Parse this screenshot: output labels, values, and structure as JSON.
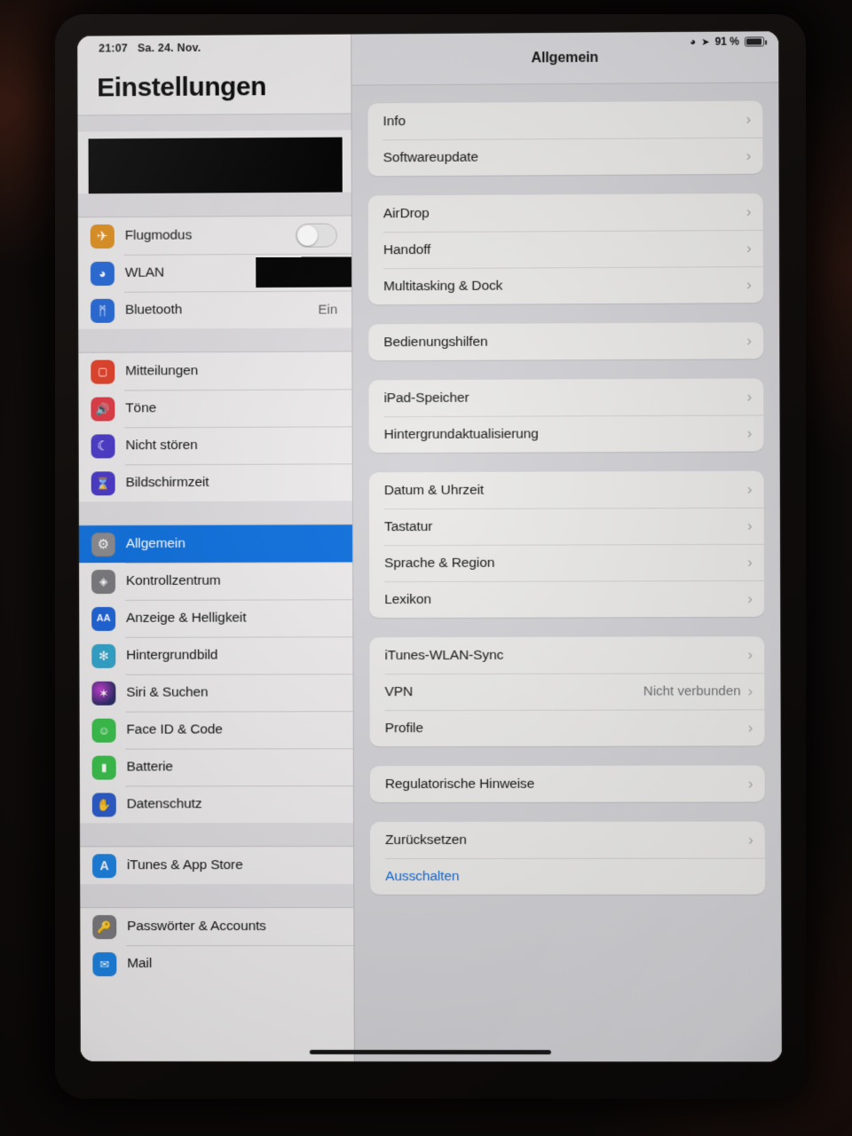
{
  "statusbar": {
    "time": "21:07",
    "date": "Sa. 24. Nov.",
    "wifi_icon": "wifi-icon",
    "location_icon": "location-arrow-icon",
    "battery_percent": "91 %",
    "battery_icon": "battery-icon"
  },
  "sidebar": {
    "title": "Einstellungen",
    "account_redacted": true,
    "groups": [
      {
        "items": [
          {
            "label": "Flugmodus",
            "icon": "airplane-icon",
            "glyph": "✈",
            "icon_color": "#e08c16",
            "control": "toggle",
            "toggle_on": false
          },
          {
            "label": "WLAN",
            "icon": "wifi-icon",
            "glyph": "◔",
            "icon_color": "#1c63d8",
            "control": "redacted"
          },
          {
            "label": "Bluetooth",
            "icon": "bluetooth-icon",
            "glyph": "ᛗ",
            "icon_color": "#1c63d8",
            "value": "Ein"
          }
        ]
      },
      {
        "items": [
          {
            "label": "Mitteilungen",
            "icon": "notifications-icon",
            "glyph": "▢",
            "icon_color": "#e23a22"
          },
          {
            "label": "Töne",
            "icon": "sounds-icon",
            "glyph": "◂",
            "icon_color": "#e0343f"
          },
          {
            "label": "Nicht stören",
            "icon": "moon-icon",
            "glyph": "☾",
            "icon_color": "#4634c9"
          },
          {
            "label": "Bildschirmzeit",
            "icon": "hourglass-icon",
            "glyph": "⧗",
            "icon_color": "#4634c9"
          }
        ]
      },
      {
        "items": [
          {
            "label": "Allgemein",
            "icon": "gear-icon",
            "glyph": "⚙",
            "icon_color": "#8b8a8e",
            "selected": true
          },
          {
            "label": "Kontrollzentrum",
            "icon": "control-center-icon",
            "glyph": "⚇",
            "icon_color": "#7a7a7e"
          },
          {
            "label": "Anzeige & Helligkeit",
            "icon": "display-brightness-icon",
            "glyph": "AA",
            "icon_color": "#1c63d8"
          },
          {
            "label": "Hintergrundbild",
            "icon": "wallpaper-icon",
            "glyph": "✻",
            "icon_color": "#30a4cc"
          },
          {
            "label": "Siri & Suchen",
            "icon": "siri-icon",
            "glyph": "✦",
            "icon_color": "#13111a"
          },
          {
            "label": "Face ID & Code",
            "icon": "face-id-icon",
            "glyph": "☺",
            "icon_color": "#39c04b"
          },
          {
            "label": "Batterie",
            "icon": "battery-icon",
            "glyph": "▬",
            "icon_color": "#39c04b"
          },
          {
            "label": "Datenschutz",
            "icon": "privacy-hand-icon",
            "glyph": "✋",
            "icon_color": "#2a5ccc"
          }
        ]
      },
      {
        "items": [
          {
            "label": "iTunes & App Store",
            "icon": "app-store-icon",
            "glyph": "A",
            "icon_color": "#1c82e0"
          }
        ]
      },
      {
        "items": [
          {
            "label": "Passwörter & Accounts",
            "icon": "key-icon",
            "glyph": "⚷",
            "icon_color": "#7a7a7e"
          },
          {
            "label": "Mail",
            "icon": "mail-icon",
            "glyph": "✉",
            "icon_color": "#1c82e0"
          }
        ]
      }
    ]
  },
  "detail": {
    "title": "Allgemein",
    "groups": [
      {
        "rows": [
          {
            "label": "Info",
            "chevron": "›"
          },
          {
            "label": "Softwareupdate",
            "chevron": "›"
          }
        ]
      },
      {
        "rows": [
          {
            "label": "AirDrop",
            "chevron": "›"
          },
          {
            "label": "Handoff",
            "chevron": "›"
          },
          {
            "label": "Multitasking & Dock",
            "chevron": "›"
          }
        ]
      },
      {
        "rows": [
          {
            "label": "Bedienungshilfen",
            "chevron": "›"
          }
        ]
      },
      {
        "rows": [
          {
            "label": "iPad-Speicher",
            "chevron": "›"
          },
          {
            "label": "Hintergrundaktualisierung",
            "chevron": "›"
          }
        ]
      },
      {
        "rows": [
          {
            "label": "Datum & Uhrzeit",
            "chevron": "›"
          },
          {
            "label": "Tastatur",
            "chevron": "›"
          },
          {
            "label": "Sprache & Region",
            "chevron": "›"
          },
          {
            "label": "Lexikon",
            "chevron": "›"
          }
        ]
      },
      {
        "rows": [
          {
            "label": "iTunes-WLAN-Sync",
            "chevron": "›"
          },
          {
            "label": "VPN",
            "value": "Nicht verbunden",
            "chevron": "›"
          },
          {
            "label": "Profile",
            "chevron": "›"
          }
        ]
      },
      {
        "rows": [
          {
            "label": "Regulatorische Hinweise",
            "chevron": "›"
          }
        ]
      },
      {
        "rows": [
          {
            "label": "Zurücksetzen",
            "chevron": "›"
          },
          {
            "label": "Ausschalten",
            "link": true
          }
        ]
      }
    ]
  },
  "colors": {
    "selection_blue": "#0d6fdd",
    "link_blue": "#1268d3",
    "sidebar_bg": "#eceaea",
    "detail_bg": "#d2d2d6",
    "group_bg": "#eae9e7"
  }
}
